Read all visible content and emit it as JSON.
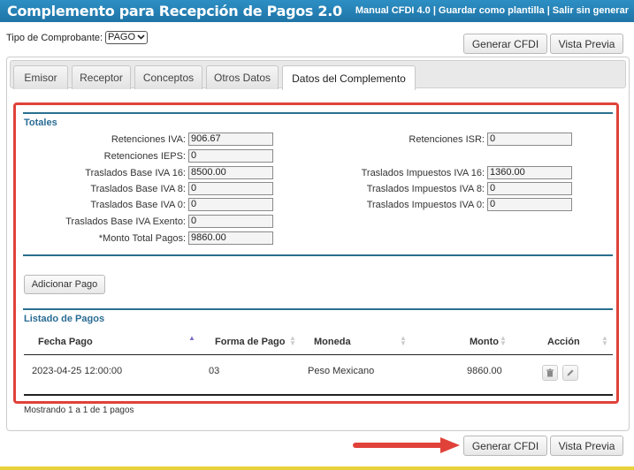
{
  "header": {
    "title": "Complemento para Recepción de Pagos  2.0",
    "links": [
      "Manual CFDI 4.0",
      "Guardar como plantilla",
      "Salir sin generar"
    ],
    "separator": "|"
  },
  "tipo_comprobante": {
    "label": "Tipo de Comprobante:",
    "value": "PAGO"
  },
  "actions": {
    "generar": "Generar CFDI",
    "vista_previa": "Vista Previa"
  },
  "tabs": [
    {
      "label": "Emisor"
    },
    {
      "label": "Receptor"
    },
    {
      "label": "Conceptos"
    },
    {
      "label": "Otros Datos"
    },
    {
      "label": "Datos del Complemento",
      "active": true
    }
  ],
  "totales": {
    "title": "Totales",
    "left_fields": [
      {
        "label": "Retenciones IVA:",
        "value": "906.67"
      },
      {
        "label": "Retenciones IEPS:",
        "value": "0"
      },
      {
        "label": "Traslados Base IVA 16:",
        "value": "8500.00"
      },
      {
        "label": "Traslados Base IVA 8:",
        "value": "0"
      },
      {
        "label": "Traslados Base IVA 0:",
        "value": "0"
      },
      {
        "label": "Traslados Base IVA Exento:",
        "value": "0"
      },
      {
        "label": "*Monto Total Pagos:",
        "value": "9860.00"
      }
    ],
    "right_fields": [
      {
        "label": "Retenciones ISR:",
        "value": "0"
      },
      {
        "label": "Traslados Impuestos IVA 16:",
        "value": "1360.00"
      },
      {
        "label": "Traslados Impuestos IVA 8:",
        "value": "0"
      },
      {
        "label": "Traslados Impuestos IVA 0:",
        "value": "0"
      }
    ]
  },
  "adicionar_pago": "Adicionar Pago",
  "listado": {
    "title": "Listado de Pagos",
    "columns": [
      "Fecha Pago",
      "Forma de Pago",
      "Moneda",
      "Monto",
      "Acción"
    ],
    "rows": [
      {
        "fecha": "2023-04-25 12:00:00",
        "forma": "03",
        "moneda": "Peso Mexicano",
        "monto": "9860.00"
      }
    ],
    "info": "Mostrando 1 a 1 de 1 pagos"
  },
  "colors": {
    "header": "#2283b8",
    "section": "#2a6c94",
    "highlight": "#e0423a",
    "accent_strip": "#e8d23a"
  },
  "icons": {
    "delete": "trash-icon",
    "edit": "pencil-icon",
    "sort": "sort-icon",
    "dropdown": "chevron-down-icon"
  }
}
